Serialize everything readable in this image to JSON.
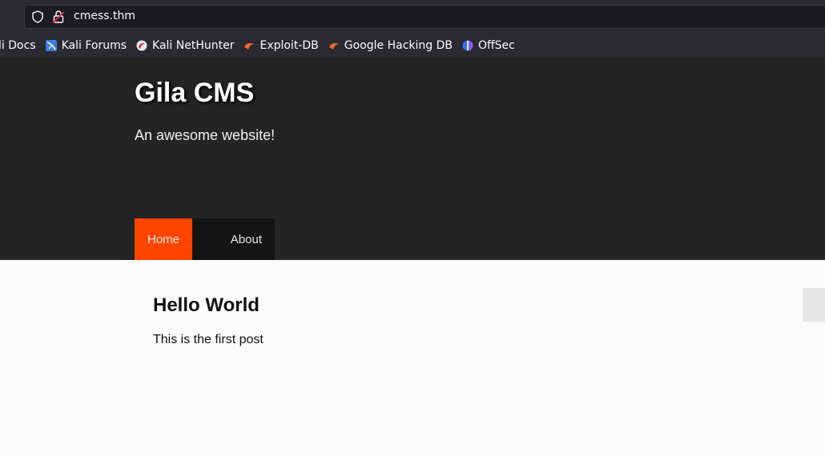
{
  "browser": {
    "url": "cmess.thm",
    "bookmarks": [
      {
        "label": "li Docs",
        "icon": "kali-icon"
      },
      {
        "label": "Kali Forums",
        "icon": "kali-icon"
      },
      {
        "label": "Kali NetHunter",
        "icon": "nethunter-icon"
      },
      {
        "label": "Exploit-DB",
        "icon": "exploit-db-icon"
      },
      {
        "label": "Google Hacking DB",
        "icon": "exploit-db-icon"
      },
      {
        "label": "OffSec",
        "icon": "offsec-icon"
      }
    ]
  },
  "site": {
    "title": "Gila CMS",
    "tagline": "An awesome website!",
    "nav": [
      {
        "label": "Home",
        "active": true
      },
      {
        "label": "About",
        "active": false
      }
    ],
    "accent_color": "#ff4500"
  },
  "post": {
    "title": "Hello World",
    "body": "This is the first post"
  }
}
